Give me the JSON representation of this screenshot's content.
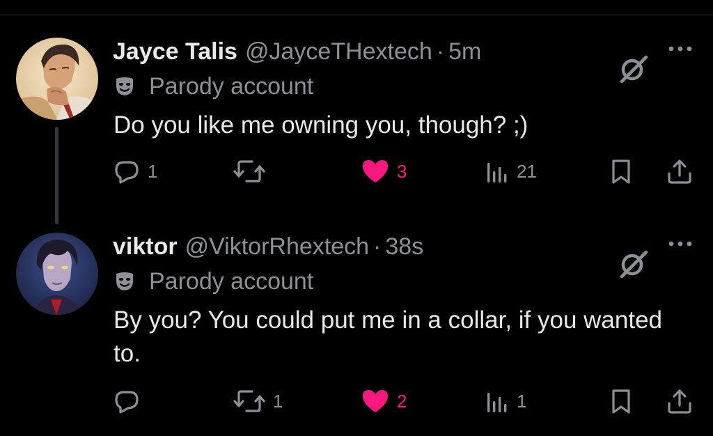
{
  "thread": {
    "posts": [
      {
        "author": {
          "name": "Jayce Talis",
          "handle": "@JayceTHextech",
          "avatar": "avatar-jayce"
        },
        "separator": "·",
        "time": "5m",
        "label": "Parody account",
        "label_icon": "theater-mask-icon",
        "text": "Do you like me owning you, though? ;)",
        "metrics": {
          "replies": "1",
          "reposts": "",
          "likes": "3",
          "views": "21"
        },
        "liked": true
      },
      {
        "author": {
          "name": "viktor",
          "handle": "@ViktorRhextech",
          "avatar": "avatar-viktor"
        },
        "separator": "·",
        "time": "38s",
        "label": "Parody account",
        "label_icon": "theater-mask-icon",
        "text": "By you? You could put me in a collar, if you wanted to.",
        "metrics": {
          "replies": "",
          "reposts": "1",
          "likes": "2",
          "views": "1"
        },
        "liked": true
      }
    ]
  },
  "colors": {
    "background": "#000000",
    "text_primary": "#e7e9ea",
    "text_secondary": "#8b9197",
    "like": "#f91880",
    "divider": "#2f3336"
  },
  "icons": {
    "reply": "reply-icon",
    "repost": "repost-icon",
    "like": "heart-icon",
    "views": "views-icon",
    "bookmark": "bookmark-icon",
    "share": "share-icon",
    "grok": "grok-icon",
    "more": "more-icon"
  }
}
